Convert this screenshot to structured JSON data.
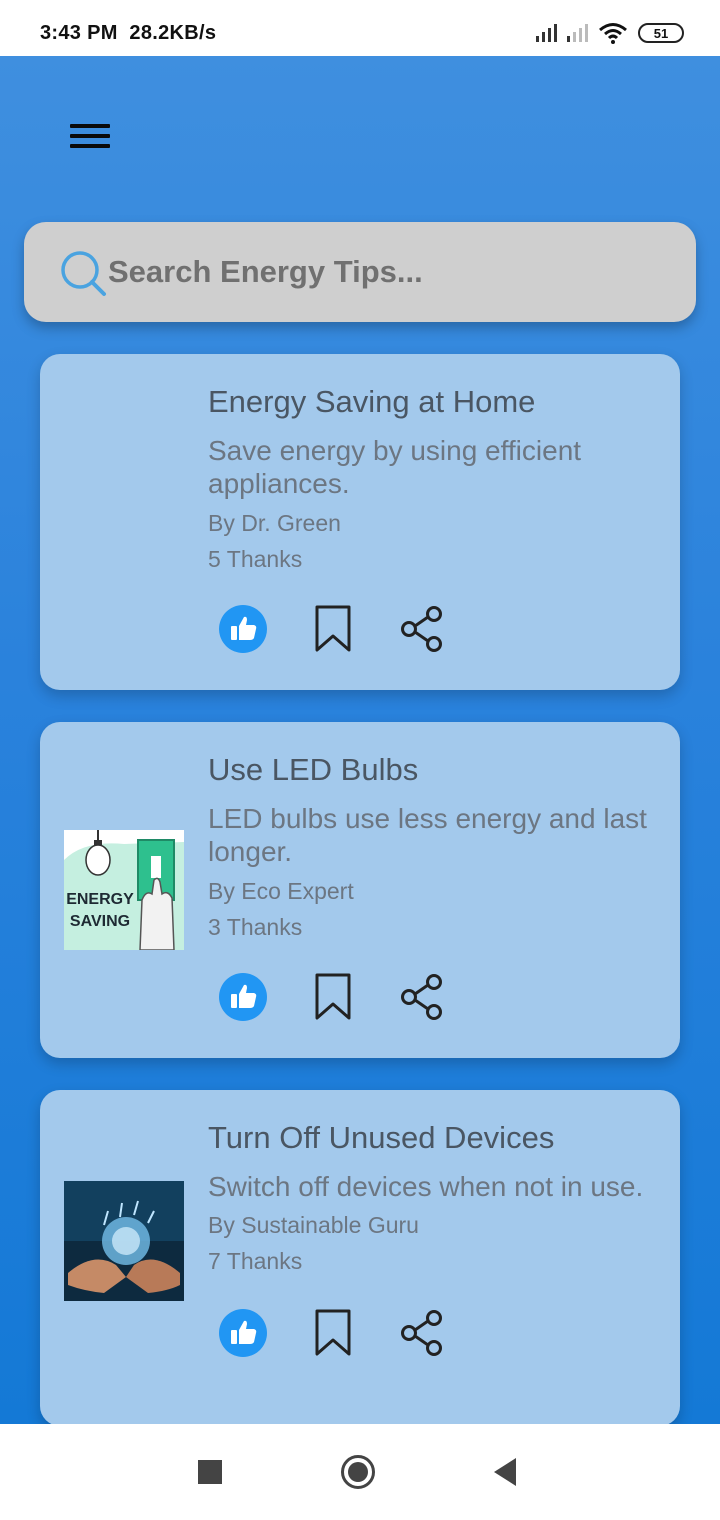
{
  "status_bar": {
    "time": "3:43 PM",
    "speed": "28.2KB/s",
    "battery": "51"
  },
  "search": {
    "placeholder": "Search Energy Tips..."
  },
  "icons": {
    "menu": "hamburger-menu-icon",
    "search": "search-icon",
    "like": "thumbs-up-icon",
    "bookmark": "bookmark-icon",
    "share": "share-icon"
  },
  "colors": {
    "accent": "#2196f3",
    "card": "#a3c9ec",
    "background": "#2a82dc"
  },
  "tips": [
    {
      "title": "Energy Saving at Home",
      "description": "Save energy by using efficient appliances.",
      "author": "By Dr. Green",
      "thanks": "5 Thanks",
      "image": "none"
    },
    {
      "title": "Use LED Bulbs",
      "description": "LED bulbs use less energy and last longer.",
      "author": "By Eco Expert",
      "thanks": "3 Thanks",
      "image": "energy-saving-illustration",
      "image_text_1": "ENERGY",
      "image_text_2": "SAVING"
    },
    {
      "title": "Turn Off Unused Devices",
      "description": "Switch off devices when not in use.",
      "author": "By Sustainable Guru",
      "thanks": "7 Thanks",
      "image": "hands-holding-globe-photo"
    }
  ]
}
